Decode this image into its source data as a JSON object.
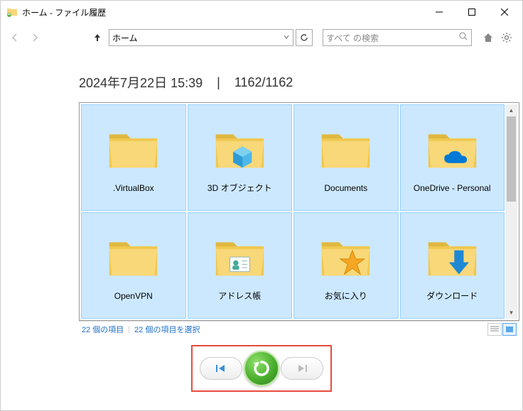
{
  "window": {
    "title": "ホーム - ファイル履歴"
  },
  "nav": {
    "address": "ホーム",
    "search_placeholder": "すべて の検索"
  },
  "timestamp": {
    "date": "2024年7月22日 15:39",
    "separator": "|",
    "counter": "1162/1162"
  },
  "items": [
    {
      "label": ".VirtualBox",
      "icon": "folder"
    },
    {
      "label": "3D オブジェクト",
      "icon": "folder-3d"
    },
    {
      "label": "Documents",
      "icon": "folder"
    },
    {
      "label": "OneDrive - Personal",
      "icon": "folder-onedrive"
    },
    {
      "label": "OpenVPN",
      "icon": "folder"
    },
    {
      "label": "アドレス帳",
      "icon": "folder-contacts"
    },
    {
      "label": "お気に入り",
      "icon": "folder-favorites"
    },
    {
      "label": "ダウンロード",
      "icon": "folder-downloads"
    }
  ],
  "status": {
    "count": "22 個の項目",
    "selected": "22 個の項目を選択"
  }
}
